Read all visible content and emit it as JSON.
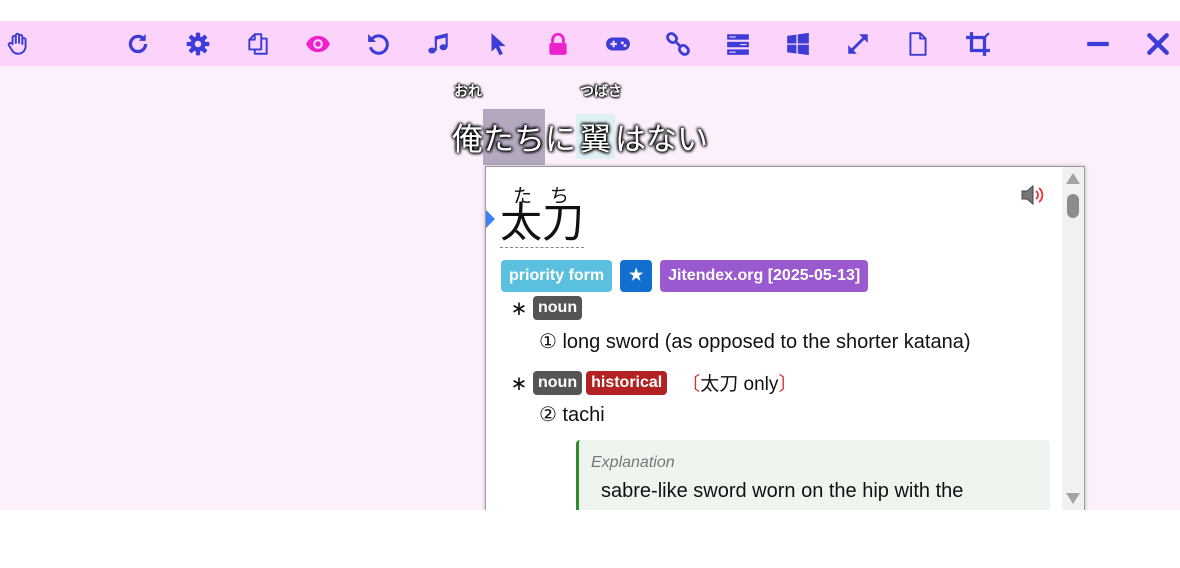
{
  "toolbar": {
    "buttons": [
      {
        "icon": "hand-icon",
        "color": "#3c3cd6"
      },
      {
        "icon": "reload-icon",
        "color": "#3c3cd6"
      },
      {
        "icon": "gear-icon",
        "color": "#3c3cd6"
      },
      {
        "icon": "copy-icon",
        "color": "#3c3cd6"
      },
      {
        "icon": "eye-icon",
        "color": "#ee22cc"
      },
      {
        "icon": "undo-icon",
        "color": "#3c3cd6"
      },
      {
        "icon": "music-icon",
        "color": "#3c3cd6"
      },
      {
        "icon": "pointer-icon",
        "color": "#3c3cd6"
      },
      {
        "icon": "lock-icon",
        "color": "#ee22cc"
      },
      {
        "icon": "gamepad-icon",
        "color": "#3c3cd6"
      },
      {
        "icon": "link-icon",
        "color": "#3c3cd6"
      },
      {
        "icon": "list-icon",
        "color": "#3c3cd6"
      },
      {
        "icon": "windows-icon",
        "color": "#3c3cd6"
      },
      {
        "icon": "expand-icon",
        "color": "#3c3cd6"
      },
      {
        "icon": "file-icon",
        "color": "#3c3cd6"
      },
      {
        "icon": "crop-icon",
        "color": "#3c3cd6"
      },
      {
        "icon": "minimize-icon",
        "color": "#3c3cd6"
      },
      {
        "icon": "close-icon",
        "color": "#3c3cd6"
      }
    ]
  },
  "sentence": {
    "ruby_ore": "おれ",
    "ruby_tsubasa": "つばさ",
    "part1": "俺",
    "part2": "たち",
    "part3": "に",
    "part4": "翼",
    "part5": "はない"
  },
  "popup": {
    "reading": "たち",
    "headword": "太刀",
    "tags": {
      "priority": "priority form",
      "star": "★",
      "dictionary": "Jitendex.org [2025-05-13]"
    },
    "senses": [
      {
        "asterisk": "∗",
        "pos": "noun",
        "gloss": "① long sword (as opposed to the shorter katana)"
      },
      {
        "asterisk": "∗",
        "pos": "noun",
        "misc": "historical",
        "only_open": "〔",
        "only_text": "太刀 only",
        "only_close": "〕",
        "gloss": "② tachi"
      }
    ],
    "explanation_label": "Explanation",
    "explanation_text": "sabre-like sword worn on the hip with the"
  },
  "colors": {
    "toolbar_bg": "#fbd3fb",
    "app_bg": "#fdf0fd",
    "icon_blue": "#3c3cd6",
    "icon_pink": "#ee22cc"
  }
}
